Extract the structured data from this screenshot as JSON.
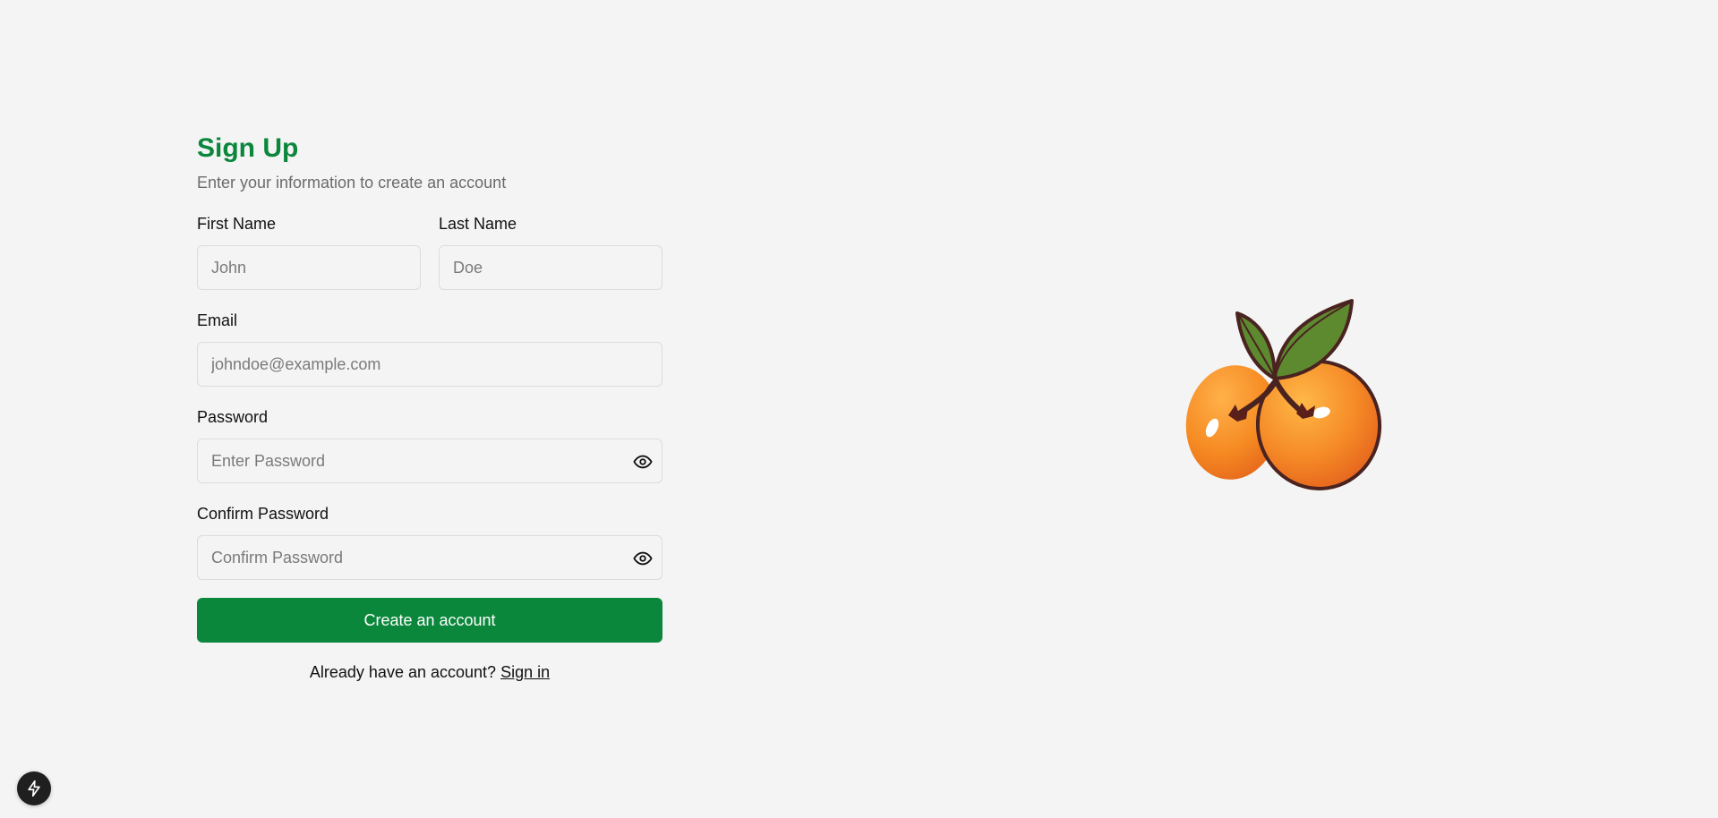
{
  "signup": {
    "title": "Sign Up",
    "subtitle": "Enter your information to create an account",
    "first_name": {
      "label": "First Name",
      "placeholder": "John",
      "value": ""
    },
    "last_name": {
      "label": "Last Name",
      "placeholder": "Doe",
      "value": ""
    },
    "email": {
      "label": "Email",
      "placeholder": "johndoe@example.com",
      "value": ""
    },
    "password": {
      "label": "Password",
      "placeholder": "Enter Password",
      "value": ""
    },
    "confirm_password": {
      "label": "Confirm Password",
      "placeholder": "Confirm Password",
      "value": ""
    },
    "submit_label": "Create an account",
    "footer_text": "Already have an account?",
    "signin_link": "Sign in"
  },
  "icons": {
    "password_toggle": "eye-icon",
    "confirm_password_toggle": "eye-icon",
    "illustration": "apricot-illustration",
    "dev_tools": "lightning-icon"
  },
  "colors": {
    "accent": "#0b873c",
    "background": "#f4f4f4",
    "fruit": "#f48a24",
    "leaf": "#5d8a2f"
  }
}
